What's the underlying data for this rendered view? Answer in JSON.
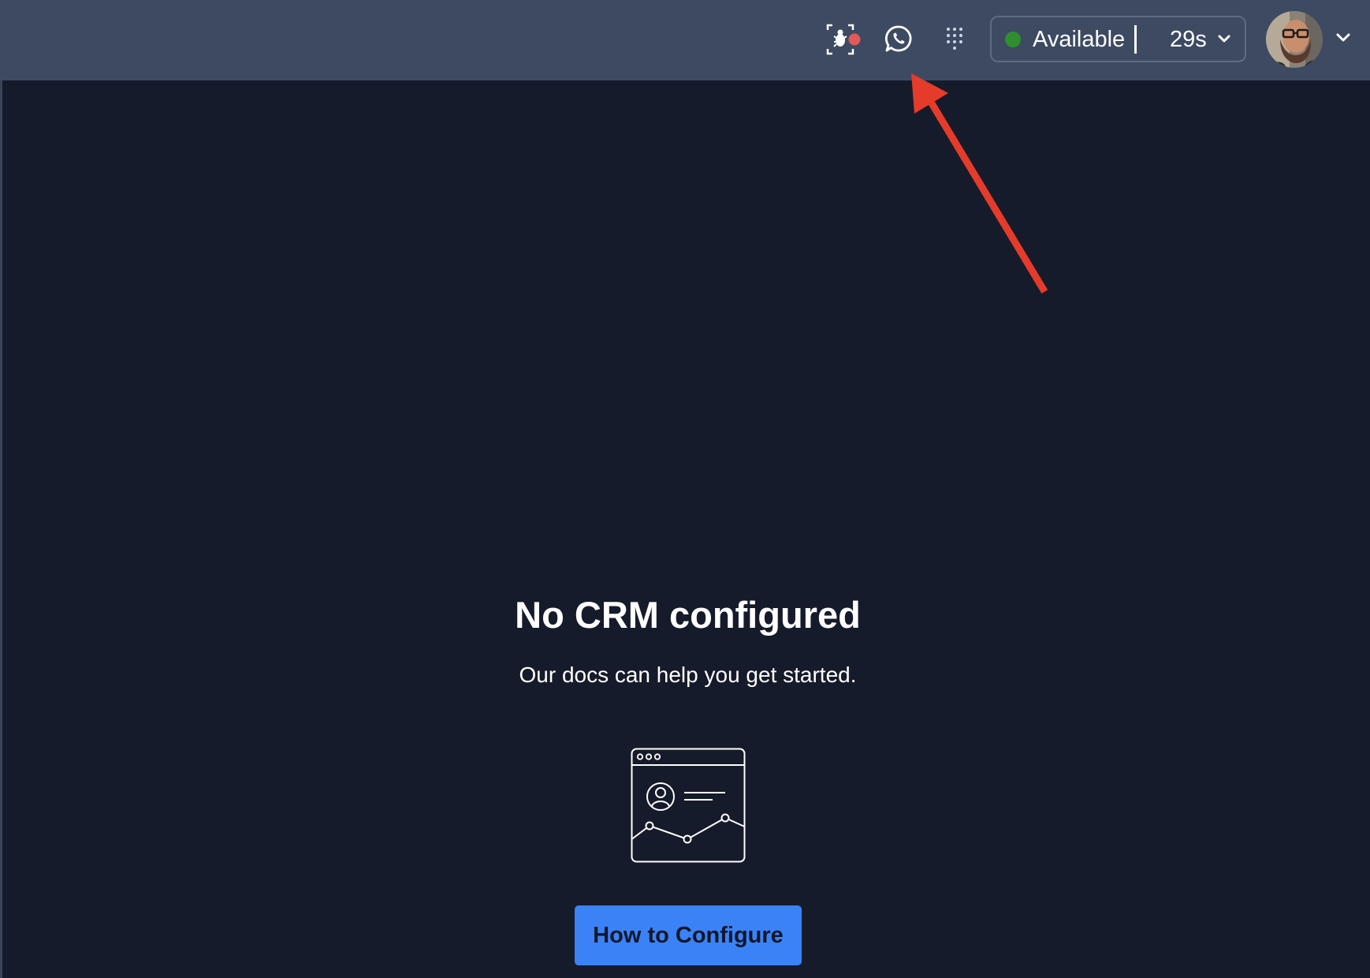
{
  "header": {
    "background": "#3d4a62",
    "icons": [
      {
        "name": "screen-record-icon"
      },
      {
        "name": "whatsapp-icon"
      },
      {
        "name": "dialpad-icon"
      }
    ],
    "status": {
      "label": "Available",
      "timer": "29s",
      "dot_color": "#2f8f2f"
    },
    "avatar": {
      "name": "user-avatar"
    }
  },
  "main": {
    "title": "No CRM configured",
    "subtitle": "Our docs can help you get started.",
    "illustration": "crm-browser-illustration-icon",
    "cta": {
      "label": "How to Configure",
      "color": "#3b82f6"
    }
  },
  "annotation": {
    "arrow_color": "#e53b2a"
  }
}
